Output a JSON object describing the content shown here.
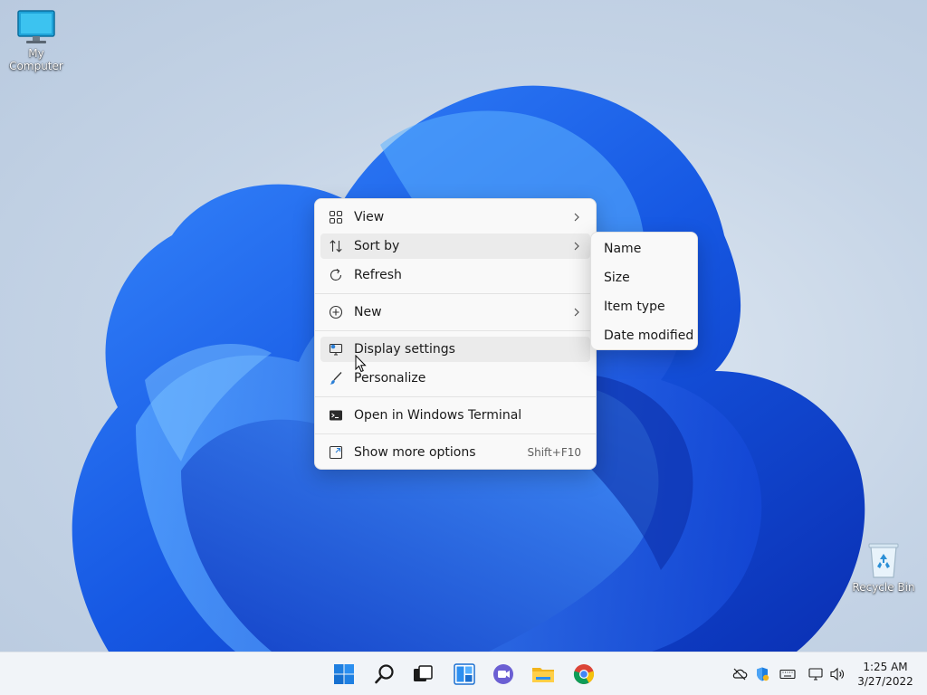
{
  "desktop": {
    "icons": [
      {
        "label": "My Computer"
      },
      {
        "label": "Recycle Bin"
      }
    ]
  },
  "context_menu": {
    "items": [
      {
        "label": "View",
        "icon": "grid-icon",
        "submenu": true
      },
      {
        "label": "Sort by",
        "icon": "sort-icon",
        "submenu": true
      },
      {
        "label": "Refresh",
        "icon": "refresh-icon"
      },
      {
        "label": "New",
        "icon": "plus-circle-icon",
        "submenu": true
      },
      {
        "label": "Display settings",
        "icon": "display-settings-icon"
      },
      {
        "label": "Personalize",
        "icon": "brush-icon"
      },
      {
        "label": "Open in Windows Terminal",
        "icon": "terminal-icon"
      },
      {
        "label": "Show more options",
        "icon": "expand-icon",
        "shortcut": "Shift+F10"
      }
    ]
  },
  "sort_submenu": {
    "items": [
      {
        "label": "Name"
      },
      {
        "label": "Size"
      },
      {
        "label": "Item type"
      },
      {
        "label": "Date modified"
      }
    ]
  },
  "taskbar": {
    "apps": [
      "start-icon",
      "search-icon",
      "task-view-icon",
      "widgets-icon",
      "chat-icon",
      "file-explorer-icon",
      "chrome-icon"
    ],
    "tray": [
      "onedrive-icon",
      "security-icon",
      "keyboard-icon",
      "network-icon",
      "volume-icon"
    ],
    "time": "1:25 AM",
    "date": "3/27/2022"
  },
  "colors": {
    "accent": "#0067c0",
    "bloom_blue": "#1a5fe0",
    "menu_bg": "#f9f9f9"
  }
}
